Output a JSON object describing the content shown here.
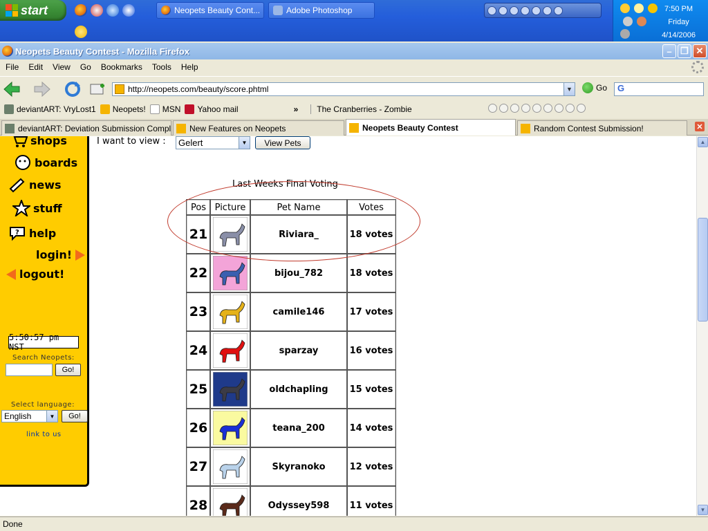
{
  "taskbar": {
    "start_label": "start",
    "tasks": [
      {
        "label": "Neopets Beauty Cont...",
        "icon": "firefox-icon"
      },
      {
        "label": "Adobe Photoshop",
        "icon": "photoshop-icon"
      }
    ],
    "clock": {
      "time": "7:50 PM",
      "day": "Friday",
      "date": "4/14/2006"
    }
  },
  "window": {
    "title": "Neopets Beauty Contest - Mozilla Firefox"
  },
  "menu": [
    "File",
    "Edit",
    "View",
    "Go",
    "Bookmarks",
    "Tools",
    "Help"
  ],
  "nav": {
    "url": "http://neopets.com/beauty/score.phtml",
    "go_label": "Go",
    "search_value": "G"
  },
  "bookmarks": [
    {
      "label": "deviantART: VryLost1",
      "icon": "deviantart-icon"
    },
    {
      "label": "Neopets!",
      "icon": "neopets-icon"
    },
    {
      "label": "MSN",
      "icon": "page-icon"
    },
    {
      "label": "Yahoo mail",
      "icon": "yahoo-icon"
    }
  ],
  "bookmarks_more": "»",
  "now_playing": "The Cranberries - Zombie",
  "tabs": [
    {
      "label": "deviantART: Deviation Submission Complete",
      "active": false
    },
    {
      "label": "New Features on Neopets",
      "active": false
    },
    {
      "label": "Neopets Beauty Contest",
      "active": true
    },
    {
      "label": "Random Contest Submission!",
      "active": false
    }
  ],
  "sidebar": {
    "links": [
      "shops",
      "boards",
      "news",
      "stuff",
      "help",
      "login!",
      "logout!"
    ],
    "nst_time": "5:50:57 pm NST",
    "search_label": "Search Neopets:",
    "search_go": "Go!",
    "language_label": "Select language:",
    "language_value": "English",
    "language_go": "Go!",
    "link_to_us": "link to us"
  },
  "view": {
    "label": "I want to view :",
    "selected": "Gelert",
    "button": "View Pets"
  },
  "table": {
    "title": "Last Weeks Final Voting",
    "headers": [
      "Pos",
      "Picture",
      "Pet Name",
      "Votes"
    ],
    "rows": [
      {
        "pos": "21",
        "name": "Riviara_",
        "votes": "18 votes",
        "color": "#8a8fa8",
        "bg": "#ffffff"
      },
      {
        "pos": "22",
        "name": "bijou_782",
        "votes": "18 votes",
        "color": "#3a5fb0",
        "bg": "#f3a4d8"
      },
      {
        "pos": "23",
        "name": "camile146",
        "votes": "17 votes",
        "color": "#e5b21a",
        "bg": "#ffffff"
      },
      {
        "pos": "24",
        "name": "sparzay",
        "votes": "16 votes",
        "color": "#e01010",
        "bg": "#ffffff"
      },
      {
        "pos": "25",
        "name": "oldchapling",
        "votes": "15 votes",
        "color": "#3b3b46",
        "bg": "#1f3a8a"
      },
      {
        "pos": "26",
        "name": "teana_200",
        "votes": "14 votes",
        "color": "#1a2fd6",
        "bg": "#fafaa0"
      },
      {
        "pos": "27",
        "name": "Skyranoko",
        "votes": "12 votes",
        "color": "#b9d2ea",
        "bg": "#ffffff"
      },
      {
        "pos": "28",
        "name": "Odyssey598",
        "votes": "11 votes",
        "color": "#5a2a1a",
        "bg": "#ffffff"
      }
    ]
  },
  "status": "Done"
}
